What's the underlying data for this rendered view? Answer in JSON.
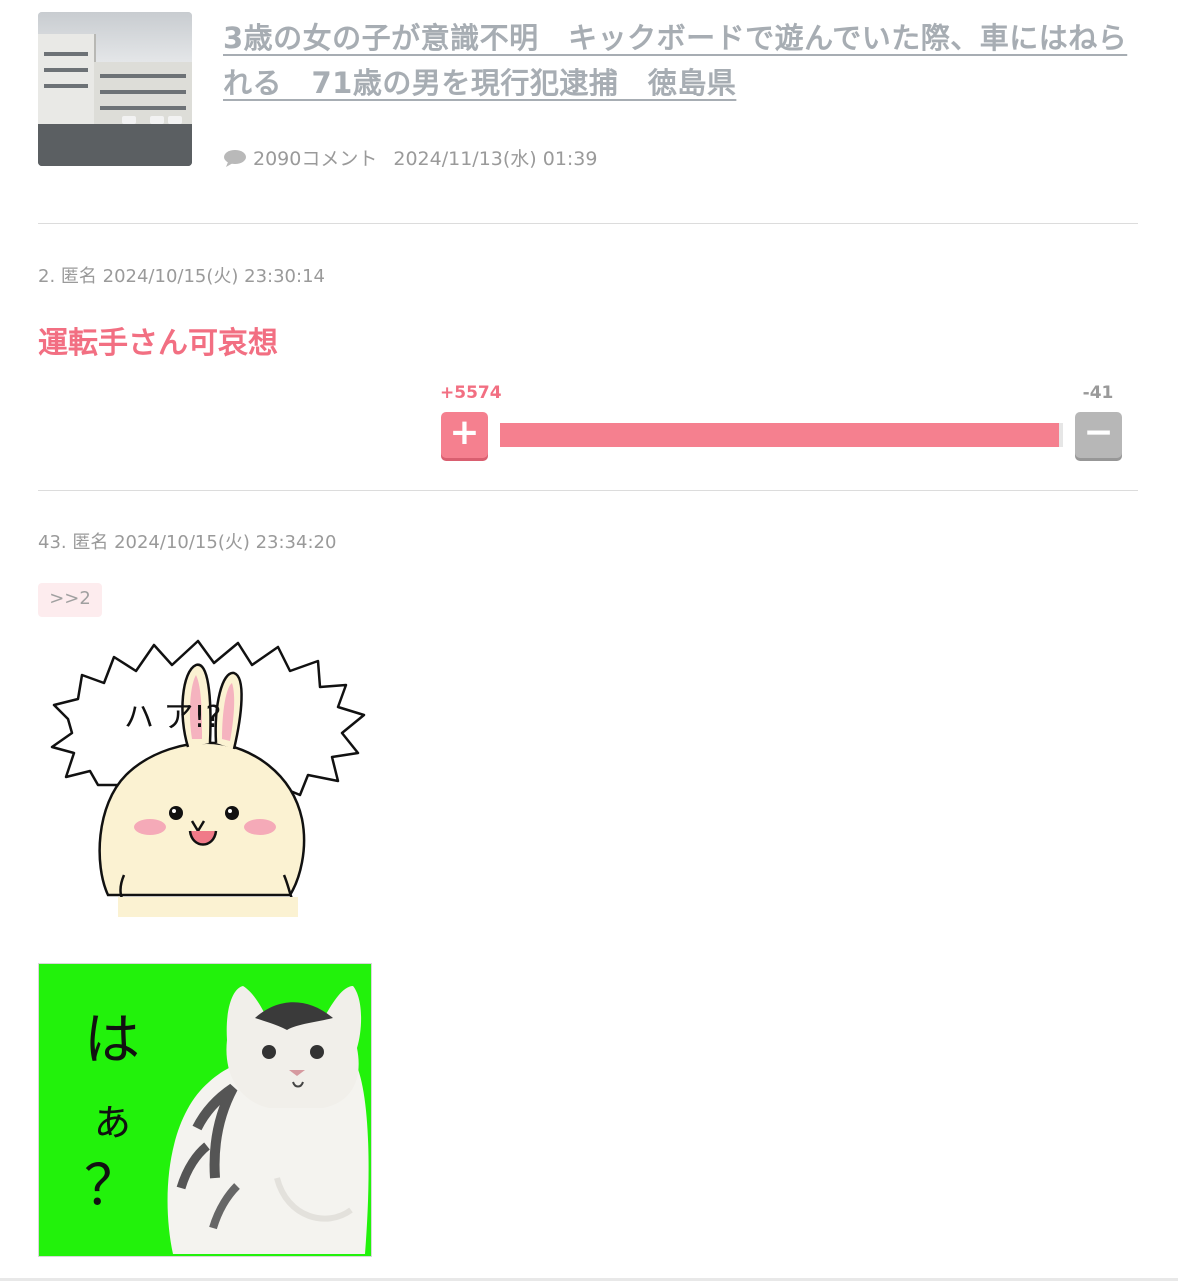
{
  "article": {
    "title": "3歳の女の子が意識不明　キックボードで遊んでいた際、車にはねられる　71歳の男を現行犯逮捕　徳島県",
    "comment_count": "2090コメント",
    "date": "2024/11/13(水) 01:39",
    "thumbnail": "police-building-photo"
  },
  "comments": [
    {
      "header": "2. 匿名 2024/10/15(火) 23:30:14",
      "text": "運転手さん可哀想",
      "plus": "+5574",
      "minus": "-41",
      "plus_button": "+",
      "minus_button": "−",
      "plus_ratio": 0.993
    },
    {
      "header": "43. 匿名 2024/10/15(火) 23:34:20",
      "anchor": ">>2",
      "sticker_text": "ハ ア!?",
      "image_text": [
        "は",
        "ぁ",
        "？"
      ]
    }
  ],
  "colors": {
    "accent": "#f26f82",
    "vote_bar": "#f5808f",
    "meta": "#9a9a9a",
    "title": "#a7adb3",
    "green_screen": "#22f20b"
  }
}
